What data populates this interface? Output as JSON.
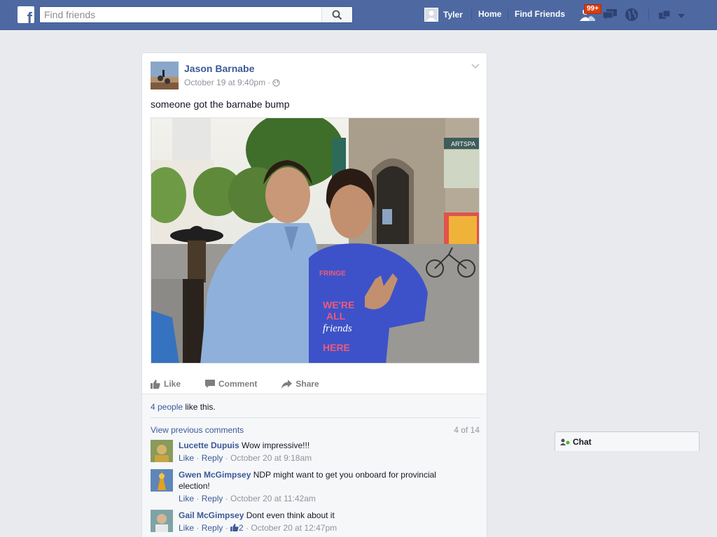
{
  "header": {
    "logo_letter": "f",
    "search_placeholder": "Find friends",
    "user_name": "Tyler",
    "nav_home": "Home",
    "nav_find_friends": "Find Friends",
    "friend_requests_badge": "99+",
    "icons": [
      "search-icon",
      "friend-requests-icon",
      "messages-icon",
      "notifications-globe-icon",
      "privacy-icon",
      "account-menu-chevron-icon"
    ]
  },
  "post": {
    "author": "Jason Barnabe",
    "timestamp": "October 19 at 9:40pm",
    "meta_separator": "·",
    "privacy_icon": "public-globe-icon",
    "text": "someone got the barnabe bump",
    "actions": {
      "like": "Like",
      "comment": "Comment",
      "share": "Share"
    },
    "likes_link": "4 people",
    "likes_suffix": " like this.",
    "view_previous": "View previous comments",
    "comment_count": "4 of 14",
    "comments": [
      {
        "name": "Lucette Dupuis",
        "text": "Wow impressive!!!",
        "like": "Like",
        "reply": "Reply",
        "time": "· October 20 at 9:18am",
        "likes": ""
      },
      {
        "name": "Gwen McGimpsey",
        "text": "NDP might want to get you onboard for provincial election!",
        "like": "Like",
        "reply": "Reply",
        "time": "· October 20 at 11:42am",
        "likes": ""
      },
      {
        "name": "Gail McGimpsey",
        "text": "Dont even think about it",
        "like": "Like",
        "reply": "Reply",
        "time": "· October 20 at 12:47pm",
        "likes": "2"
      }
    ],
    "photo_text": {
      "shirt_line1": "WE'RE",
      "shirt_line2": "ALL",
      "shirt_line3": "friends",
      "shirt_line4": "HERE",
      "shirt_logo": "FRINGE",
      "building_sign": "ARTSPA"
    }
  },
  "chat": {
    "label": "Chat"
  },
  "colors": {
    "topbar": "#4e69a2",
    "link": "#3b5998",
    "background": "#e9eaed",
    "badge": "#dd3c10"
  }
}
